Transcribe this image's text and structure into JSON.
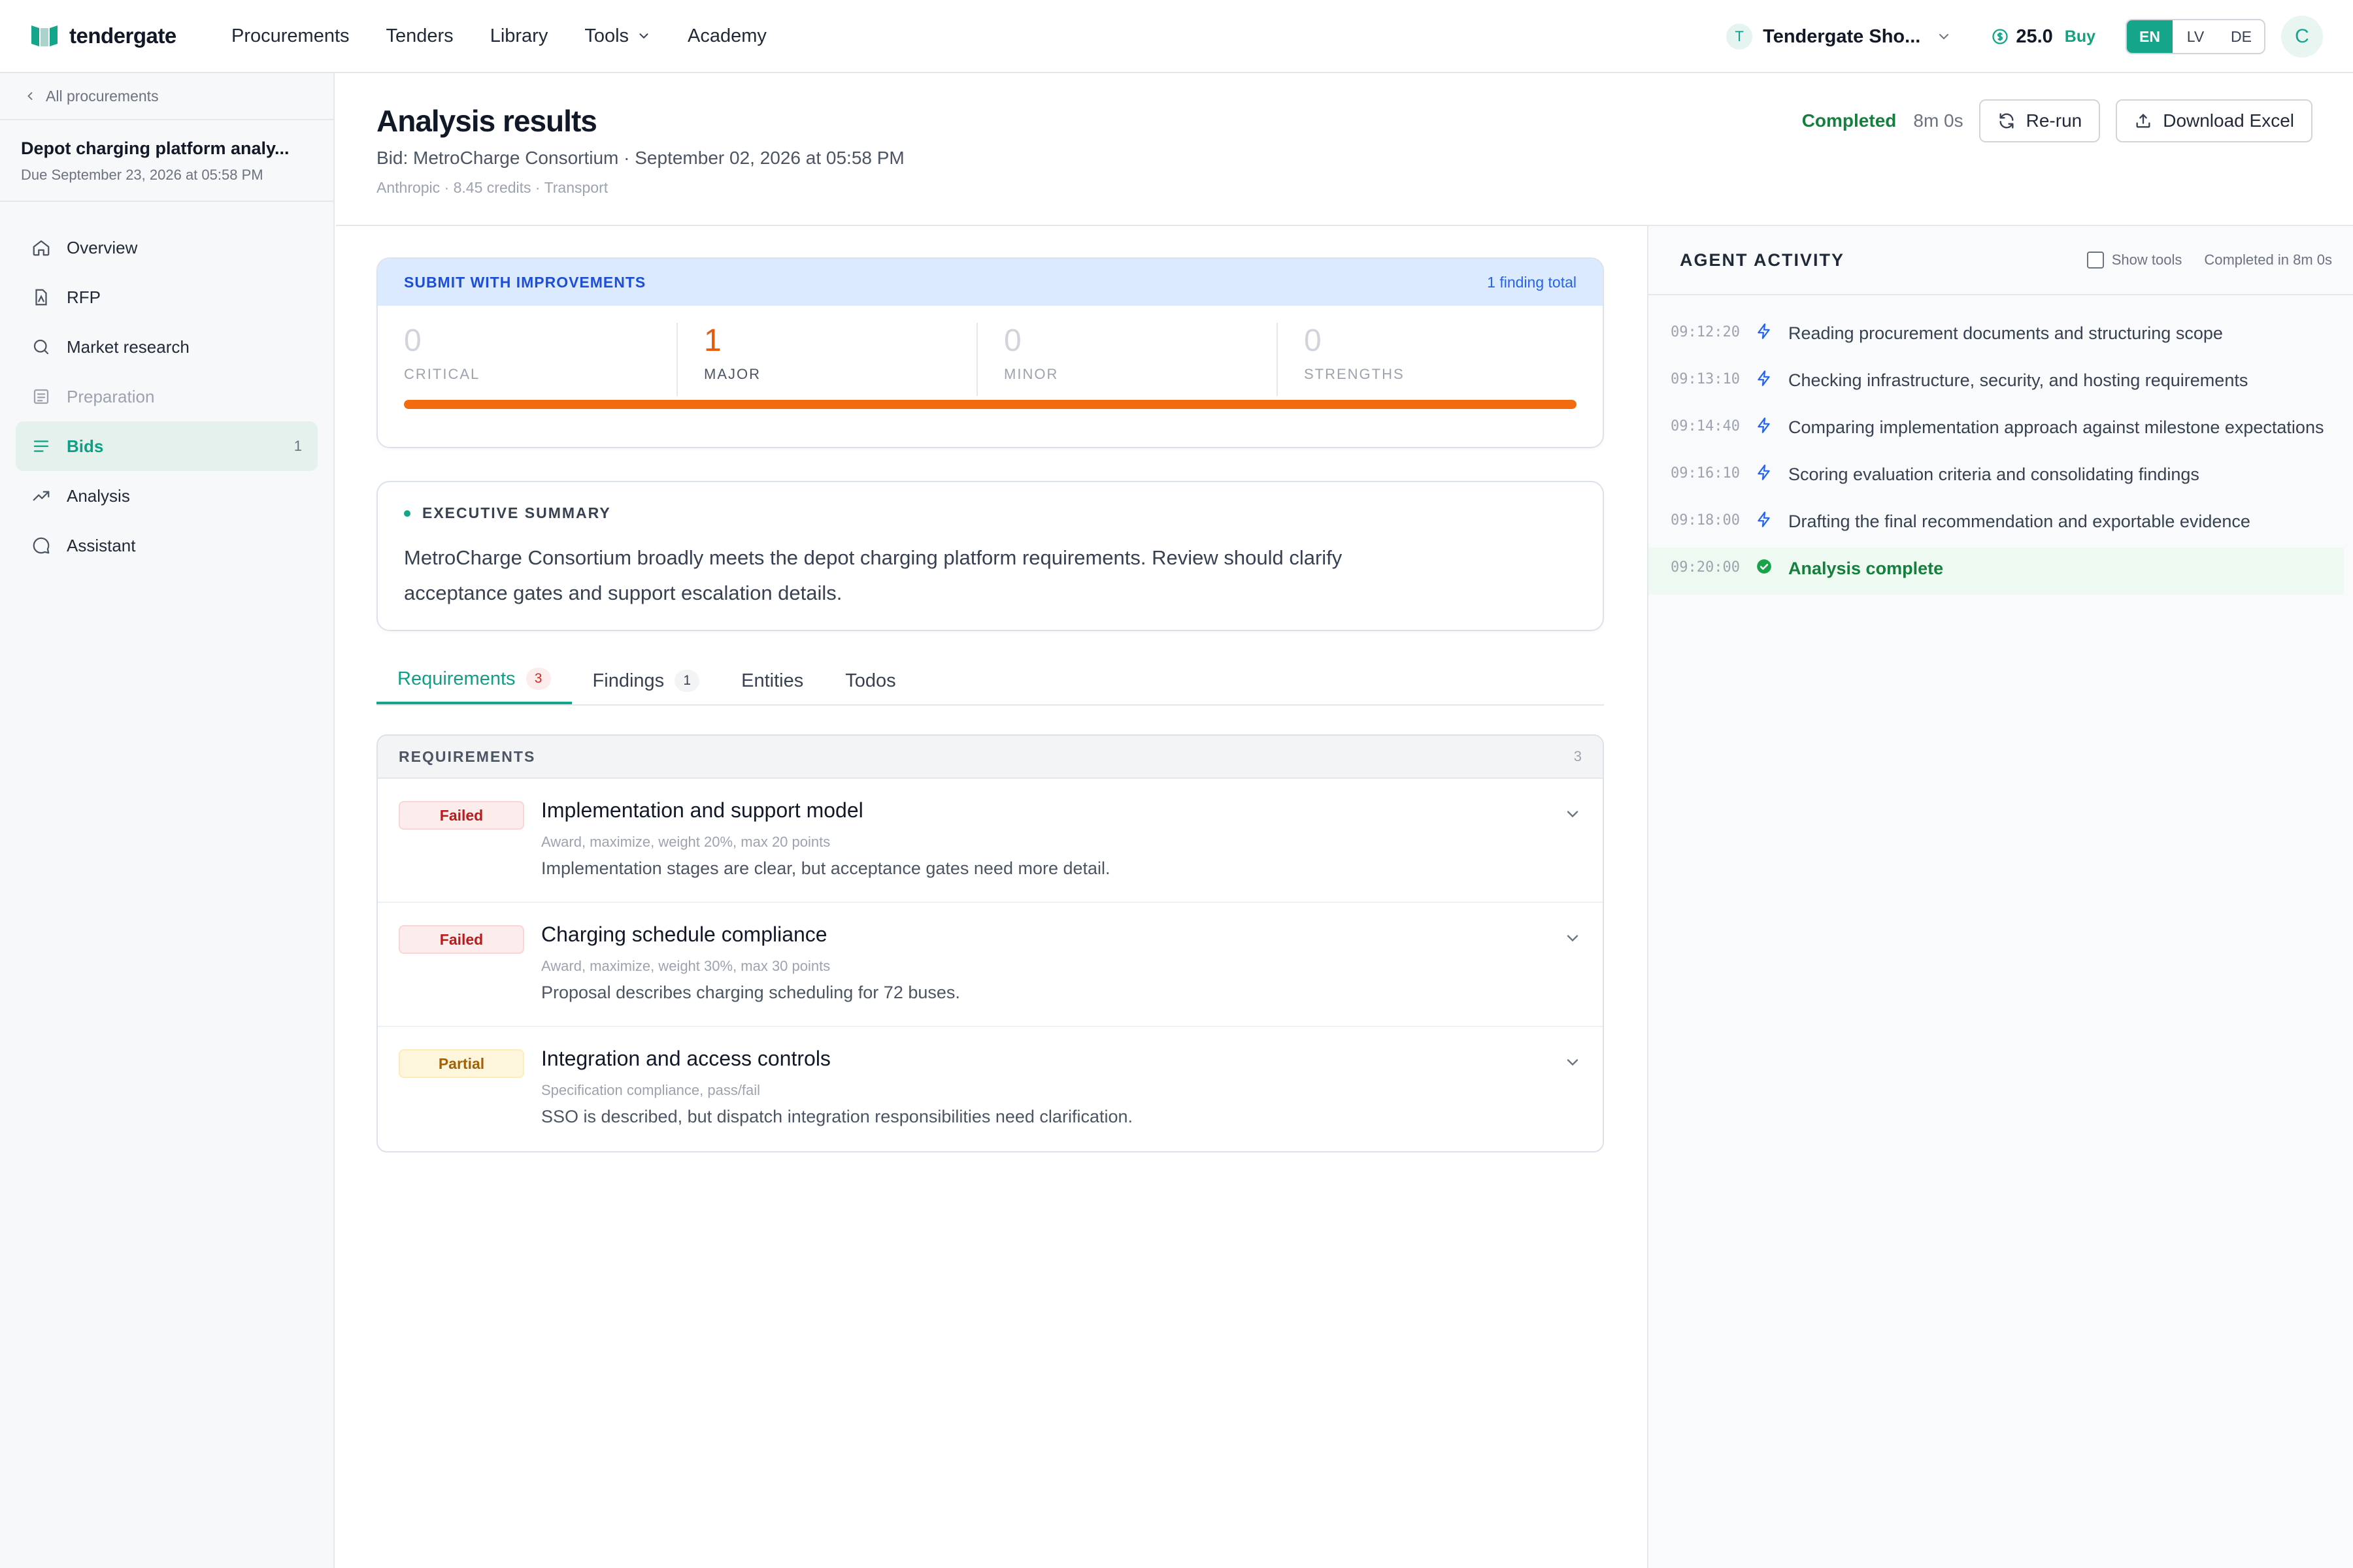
{
  "topbar": {
    "brand": "tendergate",
    "nav": [
      {
        "label": "Procurements"
      },
      {
        "label": "Tenders"
      },
      {
        "label": "Library"
      },
      {
        "label": "Tools"
      },
      {
        "label": "Academy"
      }
    ],
    "org_initial": "T",
    "org_name": "Tendergate Sho...",
    "credits": "25.0",
    "buy_label": "Buy",
    "languages": [
      "EN",
      "LV",
      "DE"
    ],
    "active_language": "EN",
    "user_initial": "C"
  },
  "sidebar": {
    "back_label": "All procurements",
    "procurement_title": "Depot charging platform analy...",
    "procurement_due": "Due September 23, 2026 at 05:58 PM",
    "items": [
      {
        "label": "Overview",
        "icon": "home-icon"
      },
      {
        "label": "RFP",
        "icon": "document-icon"
      },
      {
        "label": "Market research",
        "icon": "search-icon"
      },
      {
        "label": "Preparation",
        "icon": "checklist-icon"
      },
      {
        "label": "Bids",
        "icon": "list-icon",
        "count": "1"
      },
      {
        "label": "Analysis",
        "icon": "trend-icon"
      },
      {
        "label": "Assistant",
        "icon": "chat-icon"
      }
    ]
  },
  "header": {
    "title": "Analysis results",
    "subtitle": "Bid: MetroCharge Consortium · September 02, 2026 at 05:58 PM",
    "meta_provider": "Anthropic",
    "meta_credits": "8.45 credits",
    "meta_category": "Transport",
    "status": "Completed",
    "duration": "8m 0s",
    "rerun_label": "Re-run",
    "download_label": "Download Excel"
  },
  "verdict": {
    "label": "SUBMIT WITH IMPROVEMENTS",
    "total": "1 finding total",
    "stats": [
      {
        "value": "0",
        "label": "CRITICAL"
      },
      {
        "value": "1",
        "label": "MAJOR"
      },
      {
        "value": "0",
        "label": "MINOR"
      },
      {
        "value": "0",
        "label": "STRENGTHS"
      }
    ],
    "severity_fill_percent": 100,
    "colors": {
      "major": "#ea580c",
      "bar": "#f26b0e",
      "header_bg": "#dbeafe"
    }
  },
  "summary": {
    "label": "EXECUTIVE SUMMARY",
    "text": "MetroCharge Consortium broadly meets the depot charging platform requirements. Review should clarify acceptance gates and support escalation details."
  },
  "tabs": [
    {
      "label": "Requirements",
      "badge": "3"
    },
    {
      "label": "Findings",
      "badge": "1"
    },
    {
      "label": "Entities"
    },
    {
      "label": "Todos"
    }
  ],
  "requirements": {
    "header": "REQUIREMENTS",
    "count": "3",
    "rows": [
      {
        "status": "Failed",
        "title": "Implementation and support model",
        "meta": "Award, maximize, weight 20%, max 20 points",
        "description": "Implementation stages are clear, but acceptance gates need more detail."
      },
      {
        "status": "Failed",
        "title": "Charging schedule compliance",
        "meta": "Award, maximize, weight 30%, max 30 points",
        "description": "Proposal describes charging scheduling for 72 buses."
      },
      {
        "status": "Partial",
        "title": "Integration and access controls",
        "meta": "Specification compliance, pass/fail",
        "description": "SSO is described, but dispatch integration responsibilities need clarification."
      }
    ]
  },
  "activity": {
    "title": "AGENT ACTIVITY",
    "show_tools": "Show tools",
    "completed": "Completed in 8m 0s",
    "items": [
      {
        "time": "09:12:20",
        "text": "Reading procurement documents and structuring scope",
        "icon": "lightning-icon"
      },
      {
        "time": "09:13:10",
        "text": "Checking infrastructure, security, and hosting requirements",
        "icon": "lightning-icon"
      },
      {
        "time": "09:14:40",
        "text": "Comparing implementation approach against milestone expectations",
        "icon": "lightning-icon"
      },
      {
        "time": "09:16:10",
        "text": "Scoring evaluation criteria and consolidating findings",
        "icon": "lightning-icon"
      },
      {
        "time": "09:18:00",
        "text": "Drafting the final recommendation and exportable evidence",
        "icon": "lightning-icon"
      },
      {
        "time": "09:20:00",
        "text": "Analysis complete",
        "icon": "check-circle-icon"
      }
    ]
  }
}
